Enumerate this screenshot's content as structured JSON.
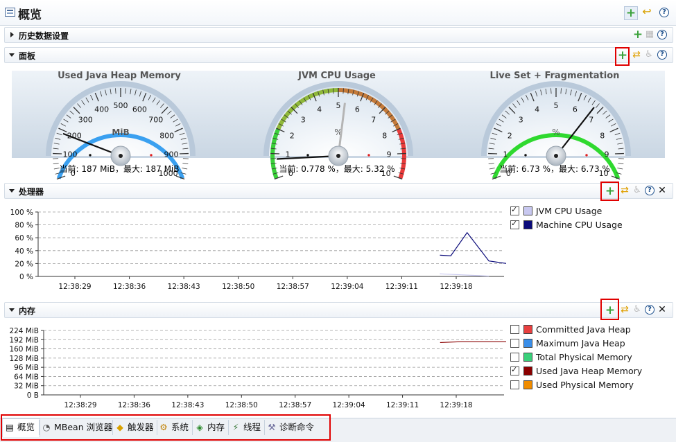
{
  "window": {
    "title": "概览"
  },
  "sections": {
    "history": {
      "label": "历史数据设置"
    },
    "dashboard": {
      "label": "面板"
    },
    "processor": {
      "label": "处理器"
    },
    "memory": {
      "label": "内存"
    }
  },
  "gauges": [
    {
      "title": "Used Java Heap Memory",
      "unit": "MiB",
      "min": 0,
      "max": 1000,
      "ticks": [
        "0",
        "100",
        "200",
        "300",
        "400",
        "500",
        "600",
        "700",
        "800",
        "900",
        "1000"
      ],
      "value": 187,
      "caption": "当前: 187 MiB，最大: 187 MiB",
      "arc_color": "#3aa0f0"
    },
    {
      "title": "JVM CPU Usage",
      "unit": "%",
      "min": 0,
      "max": 10,
      "ticks": [
        "0",
        "1",
        "2",
        "3",
        "4",
        "5",
        "6",
        "7",
        "8",
        "9",
        "10"
      ],
      "value": 0.778,
      "peak": 5.32,
      "caption": "当前: 0.778 %，最大: 5.32 %",
      "arc_color": "multi"
    },
    {
      "title": "Live Set + Fragmentation",
      "unit": "%",
      "min": 0,
      "max": 10,
      "ticks": [
        "0",
        "1",
        "2",
        "3",
        "4",
        "5",
        "6",
        "7",
        "8",
        "9",
        "10"
      ],
      "value": 6.73,
      "caption": "当前: 6.73 %，最大: 6.73 %",
      "arc_color": "#2fd92f"
    }
  ],
  "chart_data": [
    {
      "type": "line",
      "x": [
        "12:38:29",
        "12:38:36",
        "12:38:43",
        "12:38:50",
        "12:38:57",
        "12:39:04",
        "12:39:11",
        "12:39:18"
      ],
      "yticks": [
        "100 %",
        "80 %",
        "60 %",
        "40 %",
        "20 %",
        "0 %"
      ],
      "ylim": [
        0,
        100
      ],
      "series": [
        {
          "name": "JVM CPU Usage",
          "color": "#c8c8f0",
          "checked": true,
          "t": [
            12.7,
            13.6
          ],
          "values": [
            4,
            0.5
          ]
        },
        {
          "name": "Machine CPU Usage",
          "color": "#0a0a7a",
          "checked": true,
          "t": [
            12.7,
            12.9,
            13.2,
            13.6,
            14.1,
            14.6,
            15.2,
            15.7,
            16.1,
            16.6,
            17.2,
            17.6
          ],
          "values": [
            33,
            32,
            68,
            24,
            18,
            13,
            12,
            15,
            18,
            10,
            11,
            9
          ]
        }
      ],
      "grid": true,
      "legend": "right"
    },
    {
      "type": "line",
      "x": [
        "12:38:29",
        "12:38:36",
        "12:38:43",
        "12:38:50",
        "12:38:57",
        "12:39:04",
        "12:39:11",
        "12:39:18"
      ],
      "yticks": [
        "224 MiB",
        "192 MiB",
        "160 MiB",
        "128 MiB",
        "96 MiB",
        "64 MiB",
        "32 MiB",
        "0 B"
      ],
      "ylim": [
        0,
        224
      ],
      "series": [
        {
          "name": "Committed Java Heap",
          "color": "#e84040",
          "checked": false
        },
        {
          "name": "Maximum Java Heap",
          "color": "#3a8ee8",
          "checked": false
        },
        {
          "name": "Total Physical Memory",
          "color": "#3ad07a",
          "checked": false
        },
        {
          "name": "Used Java Heap Memory",
          "color": "#8a0000",
          "checked": true,
          "t": [
            12.7,
            13.1,
            14.0,
            15.0,
            16.0,
            17.0,
            17.6
          ],
          "values": [
            182,
            185,
            185,
            185,
            185,
            185,
            185
          ]
        },
        {
          "name": "Used Physical Memory",
          "color": "#f08c00",
          "checked": false
        }
      ],
      "grid": true,
      "legend": "right"
    }
  ],
  "tabs": [
    {
      "label": "概览",
      "icon": "overview-icon"
    },
    {
      "label": "MBean 浏览器",
      "icon": "mbean-icon"
    },
    {
      "label": "触发器",
      "icon": "trigger-icon"
    },
    {
      "label": "系统",
      "icon": "system-icon"
    },
    {
      "label": "内存",
      "icon": "memory-icon"
    },
    {
      "label": "线程",
      "icon": "thread-icon"
    },
    {
      "label": "诊断命令",
      "icon": "diagnostic-icon"
    }
  ]
}
